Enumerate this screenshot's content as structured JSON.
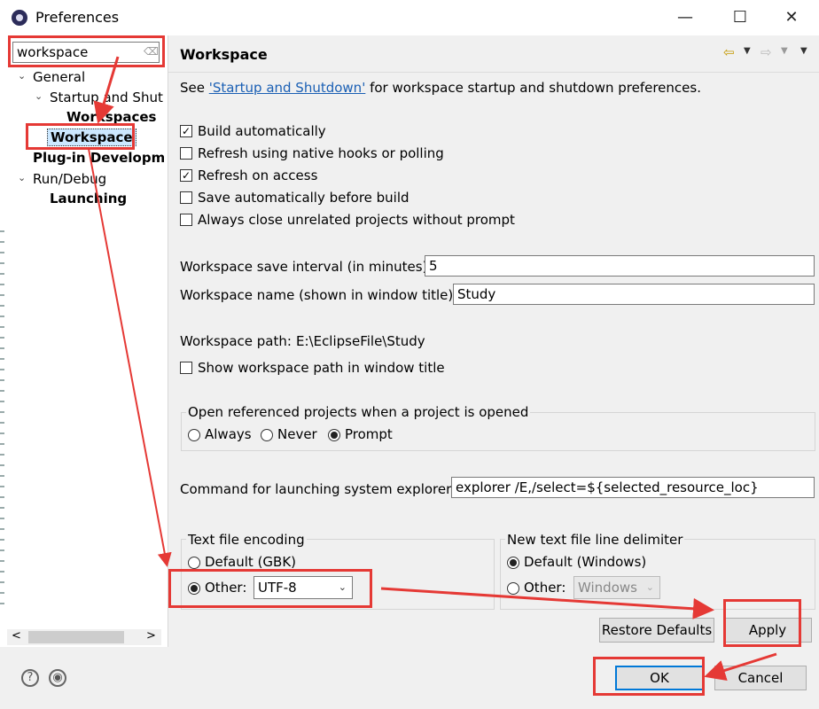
{
  "window": {
    "title": "Preferences",
    "minimize": "—",
    "maximize": "☐",
    "close": "✕"
  },
  "sidebar": {
    "search_value": "workspace",
    "search_clear": "⌫",
    "tree": {
      "general": "General",
      "startup": "Startup and Shut",
      "workspaces": "Workspaces",
      "workspace": "Workspace",
      "plugin": "Plug-in Developme",
      "rundebug": "Run/Debug",
      "launching": "Launching"
    },
    "arrow_expanded": "⌄",
    "scroll_left": "<",
    "scroll_right": ">"
  },
  "page": {
    "title": "Workspace",
    "see_prefix": "See ",
    "see_link": "'Startup and Shutdown'",
    "see_suffix": " for workspace startup and shutdown preferences.",
    "nav_back": "⇦",
    "nav_forward": "⇨",
    "nav_drop": "▼",
    "menu_drop": "▼",
    "checkboxes": [
      {
        "label": "Build automatically",
        "checked": true
      },
      {
        "label": "Refresh using native hooks or polling",
        "checked": false
      },
      {
        "label": "Refresh on access",
        "checked": true
      },
      {
        "label": "Save automatically before build",
        "checked": false
      },
      {
        "label": "Always close unrelated projects without prompt",
        "checked": false
      }
    ],
    "check_mark": "✓",
    "save_interval_label": "Workspace save interval (in minutes):",
    "save_interval_value": "5",
    "name_label": "Workspace name (shown in window title):",
    "name_value": "Study",
    "path_label": "Workspace path:",
    "path_value": "E:\\EclipseFile\\Study",
    "show_path_label": "Show workspace path in window title",
    "open_group": {
      "label": "Open referenced projects when a project is opened",
      "options": [
        "Always",
        "Never",
        "Prompt"
      ],
      "selected": "Prompt"
    },
    "explorer_label": "Command for launching system explorer:",
    "explorer_value": "explorer /E,/select=${selected_resource_loc}",
    "encoding": {
      "label": "Text file encoding",
      "default_label": "Default (GBK)",
      "other_label": "Other:",
      "other_value": "UTF-8",
      "select_arrow": "⌄"
    },
    "delimiter": {
      "label": "New text file line delimiter",
      "default_label": "Default (Windows)",
      "other_label": "Other:",
      "other_value": "Windows",
      "select_arrow": "⌄"
    },
    "restore_defaults": "Restore Defaults",
    "apply": "Apply"
  },
  "footer": {
    "help": "?",
    "import": "◉",
    "ok": "OK",
    "cancel": "Cancel"
  },
  "colors": {
    "annotation_red": "#e53935",
    "link_blue": "#1a5fb4",
    "selection": "#cce8ff"
  }
}
